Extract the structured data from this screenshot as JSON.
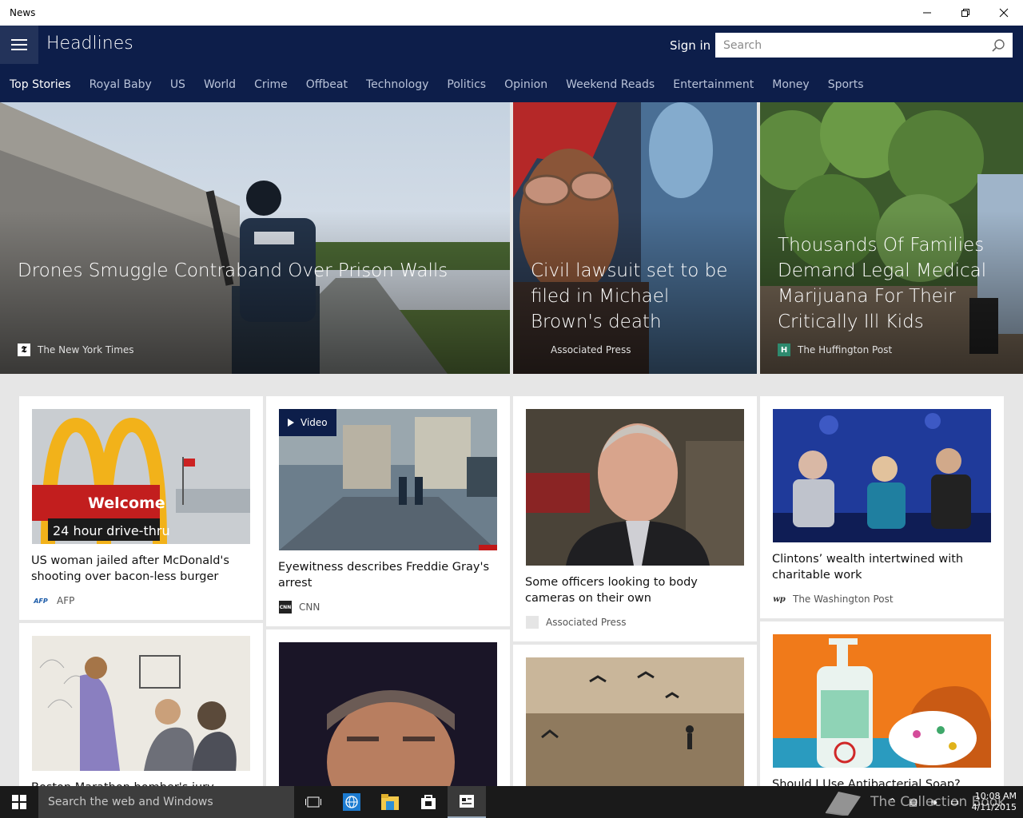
{
  "window": {
    "title": "News"
  },
  "header": {
    "title": "Headlines",
    "signin": "Sign in",
    "search_placeholder": "Search"
  },
  "tabs": [
    "Top Stories",
    "Royal Baby",
    "US",
    "World",
    "Crime",
    "Offbeat",
    "Technology",
    "Politics",
    "Opinion",
    "Weekend Reads",
    "Entertainment",
    "Money",
    "Sports"
  ],
  "active_tab": "Top Stories",
  "hero": [
    {
      "headline": "Drones Smuggle Contraband Over Prison Walls",
      "source": "The New York Times",
      "image": "prison-fence-officer"
    },
    {
      "headline": "Civil lawsuit set to be filed in Michael Brown's death",
      "source": "Associated Press",
      "image": "woman-sunglasses-portrait"
    },
    {
      "headline": "Thousands Of Families Demand Legal Medical Marijuana For Their Critically Ill Kids",
      "source": "The Huffington Post",
      "image": "marijuana-plants"
    }
  ],
  "cards": [
    {
      "title": "US woman jailed after McDonald's shooting over bacon-less burger",
      "source": "AFP",
      "image": "mcdonalds-sign"
    },
    {
      "title": "Eyewitness describes Freddie Gray's arrest",
      "source": "CNN",
      "video_label": "Video",
      "image": "street-video-still"
    },
    {
      "title": "Some officers looking to body cameras on their own",
      "source": "Associated Press",
      "image": "man-portrait"
    },
    {
      "title": "Clintons’ wealth intertwined with charitable work",
      "source": "The Washington Post",
      "image": "panel-stage"
    },
    {
      "title": "Boston Marathon bomber's jury sentencing",
      "source": "",
      "image": "courtroom-sketch"
    },
    {
      "title": "",
      "source": "",
      "image": "man-close-up"
    },
    {
      "title": "",
      "source": "",
      "image": "birds-beach"
    },
    {
      "title": "Should I Use Antibacterial Soap?",
      "source": "",
      "image": "soap-illustration"
    }
  ],
  "taskbar": {
    "search_placeholder": "Search the web and Windows",
    "time": "10:08 AM",
    "date": "4/11/2015",
    "watermark": "The Collection Book"
  },
  "colors": {
    "header_bg": "#0d1e4a",
    "accent": "#0078d7"
  }
}
